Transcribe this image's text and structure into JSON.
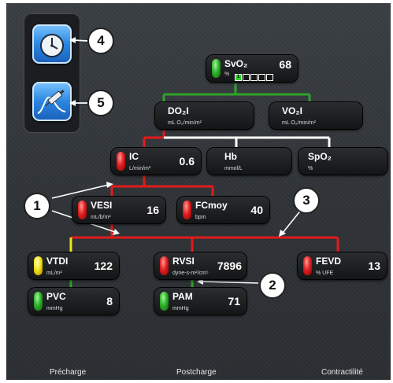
{
  "colors": {
    "red": "#e21b1b",
    "white": "#ffffff",
    "green": "#2fa22a",
    "yellow": "#f3e21a"
  },
  "callouts": [
    "4",
    "5",
    "1",
    "3",
    "2"
  ],
  "apps": [
    {
      "icon": "clock-icon"
    },
    {
      "icon": "syringe-curve-icon"
    }
  ],
  "svo2": {
    "name": "SvO₂",
    "unit": "%",
    "value": "68",
    "bar_level": "1",
    "status": "green"
  },
  "do2i": {
    "name": "DO₂I",
    "unit": "mL O₂/min/m²"
  },
  "vo2i": {
    "name": "VO₂I",
    "unit": "mL O₂/min/m²"
  },
  "ic": {
    "name": "IC",
    "unit": "L/min/m²",
    "value": "0.6",
    "status": "red"
  },
  "hb": {
    "name": "Hb",
    "unit": "mmol/L"
  },
  "spo2": {
    "name": "SpO₂",
    "unit": "%"
  },
  "vesi": {
    "name": "VESI",
    "unit": "mL/b/m²",
    "value": "16",
    "status": "red"
  },
  "fcmoy": {
    "name": "FCmoy",
    "unit": "bpm",
    "value": "40",
    "status": "red"
  },
  "vtdi": {
    "name": "VTDI",
    "unit": "mL/m²",
    "value": "122",
    "status": "yellow"
  },
  "rvsi": {
    "name": "RVSI",
    "unit": "dyne-s-m²/cm⁵",
    "value": "7896",
    "status": "red"
  },
  "fevd": {
    "name": "FEVD",
    "unit": "% UFE",
    "value": "13",
    "status": "red"
  },
  "pvc": {
    "name": "PVC",
    "unit": "mmHg",
    "value": "8",
    "status": "green"
  },
  "pam": {
    "name": "PAM",
    "unit": "mmHg",
    "value": "71",
    "status": "green"
  },
  "footer": {
    "precharge": "Précharge",
    "postcharge": "Postcharge",
    "contractilite": "Contractilité"
  }
}
